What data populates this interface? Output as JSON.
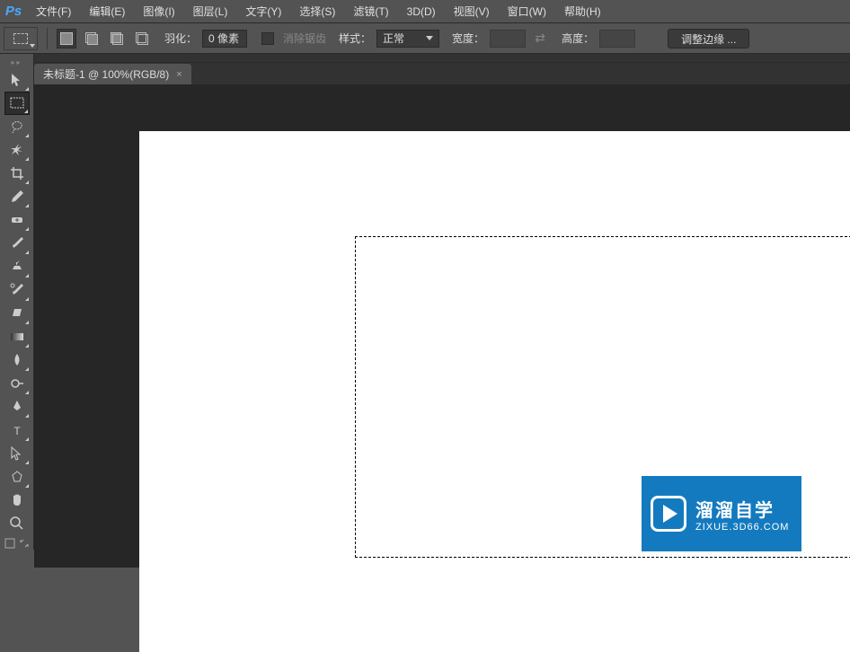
{
  "app": {
    "logo": "Ps"
  },
  "menu": {
    "file": "文件(F)",
    "edit": "编辑(E)",
    "image": "图像(I)",
    "layer": "图层(L)",
    "type": "文字(Y)",
    "select": "选择(S)",
    "filter": "滤镜(T)",
    "threed": "3D(D)",
    "view": "视图(V)",
    "window": "窗口(W)",
    "help": "帮助(H)"
  },
  "options": {
    "feather_label": "羽化：",
    "feather_value": "0 像素",
    "antialias_label": "消除锯齿",
    "style_label": "样式：",
    "style_value": "正常",
    "width_label": "宽度：",
    "height_label": "高度：",
    "refine_label": "调整边缘 ..."
  },
  "document": {
    "tab_title": "未标题-1 @ 100%(RGB/8)"
  },
  "watermark": {
    "title": "溜溜自学",
    "url": "ZIXUE.3D66.COM"
  }
}
